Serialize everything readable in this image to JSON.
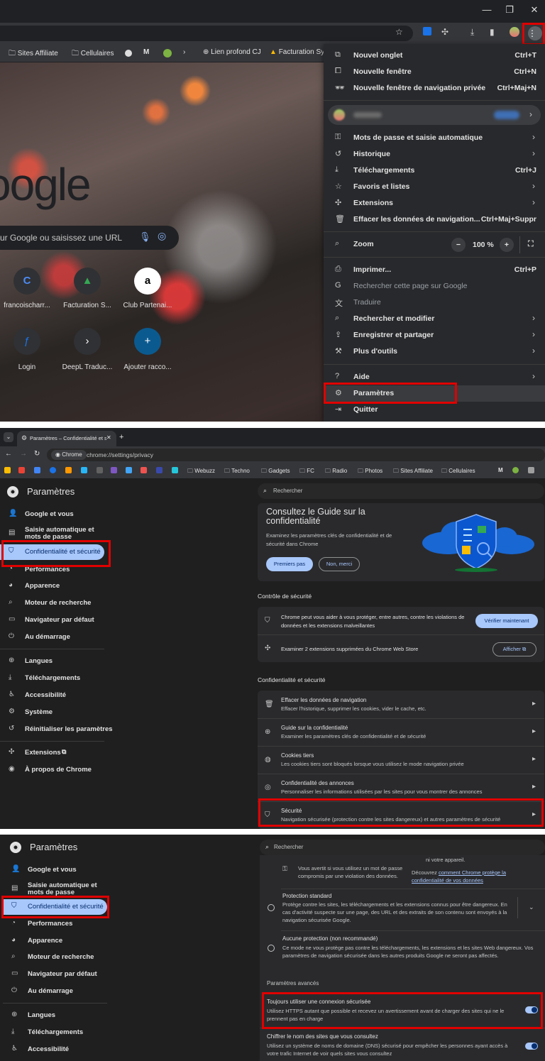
{
  "panel1": {
    "window_controls": [
      "—",
      "❐",
      "✕"
    ],
    "bookmarks": [
      {
        "label": "Sites Affiliate",
        "icon": "folder-icon"
      },
      {
        "label": "Cellulaires",
        "icon": "folder-icon"
      },
      {
        "label": "M",
        "icon": "m-icon"
      },
      {
        "label": "Lien profond CJ",
        "icon": "globe-icon"
      },
      {
        "label": "Facturation Sy",
        "icon": "drive-icon"
      }
    ],
    "google_logo": "oogle",
    "search_placeholder": "ur Google ou saisissez une URL",
    "shortcuts": [
      {
        "label": "francoischarr...",
        "glyph": "C"
      },
      {
        "label": "Facturation S...",
        "glyph": "▲"
      },
      {
        "label": "Club Partenai...",
        "glyph": "a"
      },
      {
        "label": "Login",
        "glyph": "ƒ"
      },
      {
        "label": "DeepL Traduc...",
        "glyph": "›"
      },
      {
        "label": "Ajouter racco...",
        "glyph": "+"
      }
    ],
    "menu": {
      "new_tab": {
        "label": "Nouvel onglet",
        "shortcut": "Ctrl+T"
      },
      "new_window": {
        "label": "Nouvelle fenêtre",
        "shortcut": "Ctrl+N"
      },
      "incognito": {
        "label": "Nouvelle fenêtre de navigation privée",
        "shortcut": "Ctrl+Maj+N"
      },
      "passwords": {
        "label": "Mots de passe et saisie automatique"
      },
      "history": {
        "label": "Historique"
      },
      "downloads": {
        "label": "Téléchargements",
        "shortcut": "Ctrl+J"
      },
      "bookmarks": {
        "label": "Favoris et listes"
      },
      "extensions": {
        "label": "Extensions"
      },
      "clear": {
        "label": "Effacer les données de navigation...",
        "shortcut": "Ctrl+Maj+Suppr"
      },
      "zoom": {
        "label": "Zoom",
        "minus": "−",
        "value": "100 %",
        "plus": "+"
      },
      "print": {
        "label": "Imprimer...",
        "shortcut": "Ctrl+P"
      },
      "search_page": {
        "label": "Rechercher cette page sur Google"
      },
      "translate": {
        "label": "Traduire"
      },
      "find": {
        "label": "Rechercher et modifier"
      },
      "save_share": {
        "label": "Enregistrer et partager"
      },
      "more_tools": {
        "label": "Plus d'outils"
      },
      "help": {
        "label": "Aide"
      },
      "settings": {
        "label": "Paramètres"
      },
      "quit": {
        "label": "Quitter"
      }
    }
  },
  "panel2": {
    "tab_title": "Paramètres – Confidentialité et s",
    "new_tab": "+",
    "chip": "Chrome",
    "url": "chrome://settings/privacy",
    "bookmarks": [
      "Webuzz",
      "Techno",
      "Gadgets",
      "FC",
      "Radio",
      "Photos",
      "Sites Affiliate",
      "Cellulaires",
      "M"
    ],
    "header_title": "Paramètres",
    "search_placeholder": "Rechercher",
    "nav": [
      {
        "label": "Google et vous",
        "icon": "person-icon",
        "glyph": "👤"
      },
      {
        "label": "Saisie automatique et mots de passe",
        "icon": "clipboard-icon",
        "glyph": "▤"
      },
      {
        "label": "Confidentialité et sécurité",
        "icon": "shield-icon",
        "glyph": "⛉"
      },
      {
        "label": "Performances",
        "icon": "gauge-icon",
        "glyph": "◔"
      },
      {
        "label": "Apparence",
        "icon": "palette-icon",
        "glyph": "◕"
      },
      {
        "label": "Moteur de recherche",
        "icon": "search-icon",
        "glyph": "⌕"
      },
      {
        "label": "Navigateur par défaut",
        "icon": "browser-icon",
        "glyph": "▭"
      },
      {
        "label": "Au démarrage",
        "icon": "power-icon",
        "glyph": "⏻"
      },
      {
        "label": "Langues",
        "icon": "globe-icon",
        "glyph": "⊕"
      },
      {
        "label": "Téléchargements",
        "icon": "download-icon",
        "glyph": "⤓"
      },
      {
        "label": "Accessibilité",
        "icon": "accessibility-icon",
        "glyph": "♿"
      },
      {
        "label": "Système",
        "icon": "wrench-icon",
        "glyph": "⚙"
      },
      {
        "label": "Réinitialiser les paramètres",
        "icon": "reset-icon",
        "glyph": "↺"
      },
      {
        "label": "Extensions",
        "icon": "puzzle-icon",
        "glyph": "✣"
      },
      {
        "label": "À propos de Chrome",
        "icon": "chrome-icon",
        "glyph": "◉"
      }
    ],
    "guide": {
      "title": "Consultez le Guide sur la confidentialité",
      "desc": "Examinez les paramètres clés de confidentialité et de sécurité dans Chrome",
      "btn_primary": "Premiers pas",
      "btn_secondary": "Non, merci"
    },
    "safety_heading": "Contrôle de sécurité",
    "safety_text": "Chrome peut vous aider à vous protéger, entre autres, contre les violations de données et les extensions malveillantes",
    "safety_btn": "Vérifier maintenant",
    "ext_text": "Examiner 2 extensions supprimées du Chrome Web Store",
    "ext_btn": "Afficher",
    "privacy_heading": "Confidentialité et sécurité",
    "rows": [
      {
        "title": "Effacer les données de navigation",
        "desc": "Effacer l'historique, supprimer les cookies, vider le cache, etc.",
        "glyph": "🗑"
      },
      {
        "title": "Guide sur la confidentialité",
        "desc": "Examiner les paramètres clés de confidentialité et de sécurité",
        "glyph": "⊕"
      },
      {
        "title": "Cookies tiers",
        "desc": "Les cookies tiers sont bloqués lorsque vous utilisez le mode navigation privée",
        "glyph": "◍"
      },
      {
        "title": "Confidentialité des annonces",
        "desc": "Personnaliser les informations utilisées par les sites pour vous montrer des annonces",
        "glyph": "◎"
      },
      {
        "title": "Sécurité",
        "desc": "Navigation sécurisée (protection contre les sites dangereux) et autres paramètres de sécurité",
        "glyph": "⛉"
      }
    ]
  },
  "panel3": {
    "header_title": "Paramètres",
    "search_placeholder": "Rechercher",
    "nav": [
      {
        "label": "Google et vous",
        "glyph": "👤"
      },
      {
        "label": "Saisie automatique et mots de passe",
        "glyph": "▤"
      },
      {
        "label": "Confidentialité et sécurité",
        "glyph": "⛉"
      },
      {
        "label": "Performances",
        "glyph": "◔"
      },
      {
        "label": "Apparence",
        "glyph": "◕"
      },
      {
        "label": "Moteur de recherche",
        "glyph": "⌕"
      },
      {
        "label": "Navigateur par défaut",
        "glyph": "▭"
      },
      {
        "label": "Au démarrage",
        "glyph": "⏻"
      },
      {
        "label": "Langues",
        "glyph": "⊕"
      },
      {
        "label": "Téléchargements",
        "glyph": "⤓"
      },
      {
        "label": "Accessibilité",
        "glyph": "♿"
      }
    ],
    "top_left": "Vous avertit si vous utilisez un mot de passe compromis par une violation des données.",
    "top_right_1": "ni votre appareil.",
    "top_right_2": "Découvrez",
    "top_right_link": "comment Chrome protège la confidentialité de vos données",
    "standard_title": "Protection standard",
    "standard_desc": "Protège contre les sites, les téléchargements et les extensions connus pour être dangereux. En cas d'activité suspecte sur une page, des URL et des extraits de son contenu sont envoyés à la navigation sécurisée Google.",
    "none_title": "Aucune protection (non recommandé)",
    "none_desc": "Ce mode ne vous protège pas contre les téléchargements, les extensions et les sites Web dangereux. Vos paramètres de navigation sécurisée dans les autres produits Google ne seront pas affectés.",
    "advanced_heading": "Paramètres avancés",
    "https_title": "Toujours utiliser une connexion sécurisée",
    "https_desc": "Utilisez HTTPS autant que possible et recevez un avertissement avant de charger des sites qui ne le prennent pas en charge",
    "dns_title": "Chiffrer le nom des sites que vous consultez",
    "dns_desc": "Utilisez un système de noms de domaine (DNS) sécurisé pour empêcher les personnes ayant accès à votre trafic Internet de voir quels sites vous consultez"
  }
}
